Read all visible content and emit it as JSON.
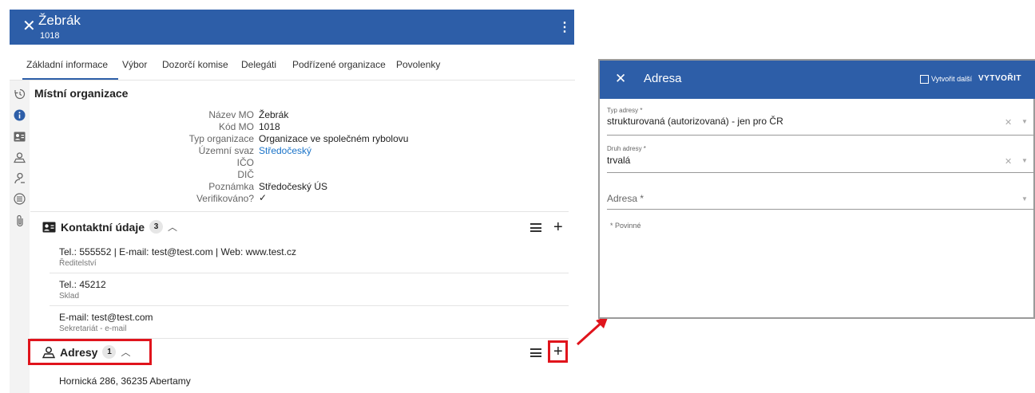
{
  "header": {
    "title": "Žebrák",
    "subtitle": "1018",
    "close_icon": "close-icon",
    "menu_icon": "more-vert-icon"
  },
  "tabs": [
    {
      "label": "Základní informace",
      "active": true
    },
    {
      "label": "Výbor"
    },
    {
      "label": "Dozorčí komise"
    },
    {
      "label": "Delegáti"
    },
    {
      "label": "Podřízené organizace"
    },
    {
      "label": "Povolenky"
    }
  ],
  "rail_icons": [
    "history-icon",
    "info-icon",
    "contact-card-icon",
    "map-marker-icon",
    "person-key-icon",
    "list-circle-icon",
    "attachment-icon"
  ],
  "local_org": {
    "title": "Místní organizace",
    "rows": [
      {
        "label": "Název MO",
        "value": "Žebrák"
      },
      {
        "label": "Kód MO",
        "value": "1018"
      },
      {
        "label": "Typ organizace",
        "value": "Organizace ve společném rybolovu"
      },
      {
        "label": "Územní svaz",
        "value": "Středočeský",
        "link": true
      },
      {
        "label": "IČO",
        "value": ""
      },
      {
        "label": "DIČ",
        "value": ""
      },
      {
        "label": "Poznámka",
        "value": "Středočeský ÚS"
      },
      {
        "label": "Verifikováno?",
        "value": "✓"
      }
    ]
  },
  "contacts": {
    "title": "Kontaktní údaje",
    "count": "3",
    "items": [
      {
        "line": "Tel.: 555552 | E-mail: test@test.com | Web: www.test.cz",
        "sub": "Ředitelství"
      },
      {
        "line": "Tel.: 45212",
        "sub": "Sklad"
      },
      {
        "line": "E-mail: test@test.com",
        "sub": "Sekretariát - e-mail"
      }
    ]
  },
  "addresses": {
    "title": "Adresy",
    "count": "1",
    "items": [
      {
        "line": "Hornická 286, 36235 Abertamy"
      }
    ]
  },
  "dialog": {
    "title": "Adresa",
    "create_another_label": "Vytvořit další",
    "create_button": "VYTVOŘIT",
    "fields": [
      {
        "label": "Typ adresy *",
        "value": "strukturovaná (autorizovaná) - jen pro ČR"
      },
      {
        "label": "Druh adresy *",
        "value": "trvalá"
      },
      {
        "label": "Adresa *",
        "value": ""
      }
    ],
    "required_note": "* Povinné"
  },
  "colors": {
    "primary": "#2d5ea8",
    "highlight": "#e0141c",
    "link": "#1a73c8"
  }
}
